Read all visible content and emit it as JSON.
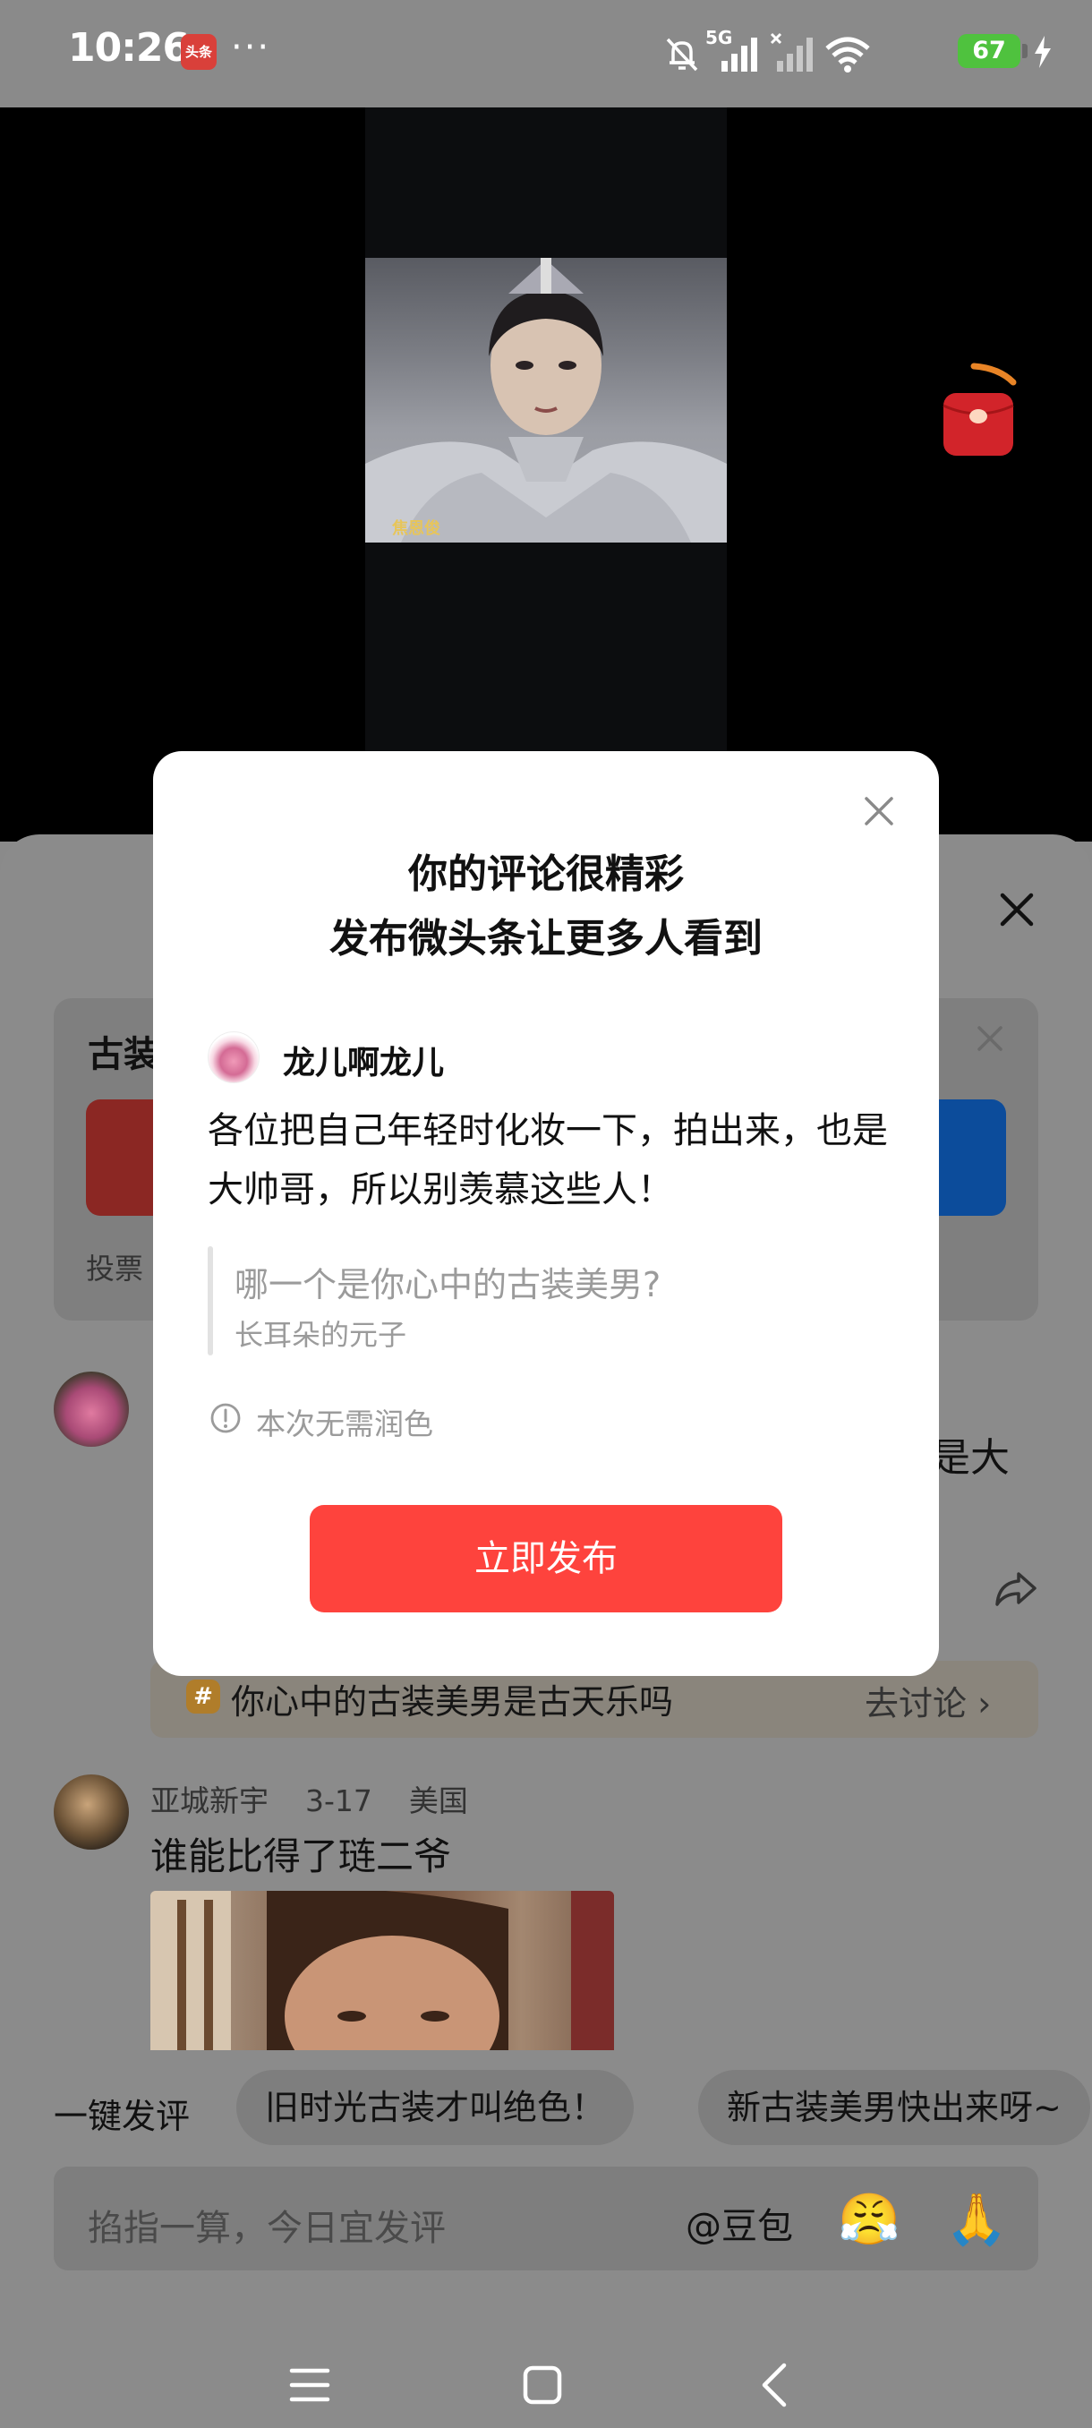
{
  "status_bar": {
    "time": "10:26",
    "app_badge": "头条",
    "more": "···",
    "network": "5G",
    "battery": "67"
  },
  "video": {
    "caption": "焦恩俊"
  },
  "background": {
    "card_title": "古装",
    "vote_label": "投票",
    "clipped_comment_tail": "是大",
    "topic": {
      "hash": "#",
      "text": "你心中的古装美男是古天乐吗",
      "action": "去讨论 ›"
    },
    "comment2": {
      "user": "亚城新宇",
      "date": "3-17",
      "location": "美国",
      "text": "谁能比得了琏二爷"
    },
    "quick_reply": {
      "label": "一键发评",
      "chips": [
        "旧时光古装才叫绝色！",
        "新古装美男快出来呀~"
      ]
    },
    "input": {
      "placeholder": "掐指一算，今日宜发评",
      "doubao": "@豆包",
      "emoji1": "😤",
      "emoji2": "🙏"
    }
  },
  "modal": {
    "title_line1": "你的评论很精彩",
    "title_line2": "发布微头条让更多人看到",
    "username": "龙儿啊龙儿",
    "comment": "各位把自己年轻时化妆一下，拍出来，也是大帅哥，所以别羡慕这些人！",
    "quote_title": "哪一个是你心中的古装美男?",
    "quote_author": "长耳朵的元子",
    "info": "本次无需润色",
    "publish": "立即发布"
  },
  "colors": {
    "accent_red": "#fe433d",
    "overlay_gray": "#8a8a8a"
  }
}
